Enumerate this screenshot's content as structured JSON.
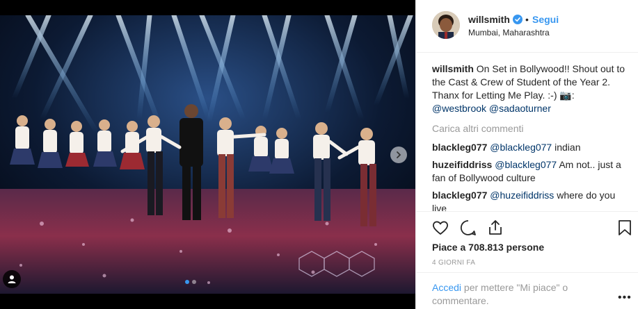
{
  "post": {
    "username": "willsmith",
    "bullet": "•",
    "follow_label": "Segui",
    "location": "Mumbai, Maharashtra",
    "caption": {
      "username": "willsmith",
      "text": "On Set in Bollywood!! Shout out to the Cast & Crew of Student of the Year 2. Thanx for Letting Me Play. :-) 📷:",
      "mention1": "@westbrook",
      "mention2": "@sadaoturner"
    },
    "load_more": "Carica altri commenti",
    "comments": [
      {
        "user": "blackleg077",
        "mention": "@blackleg077",
        "text": "indian"
      },
      {
        "user": "huzeifiddriss",
        "mention": "@blackleg077",
        "text": "Am not.. just a fan of Bollywood culture"
      },
      {
        "user": "blackleg077",
        "mention": "@huzeifiddriss",
        "text": "where do you live"
      }
    ],
    "likes": "Piace a 708.813 persone",
    "time_ago": "4 GIORNI FA",
    "footer": {
      "login_link": "Accedi",
      "login_text": "per mettere \"Mi piace\" o commentare.",
      "more": "•••"
    }
  },
  "media": {
    "carousel_total": 2,
    "carousel_active": 1
  },
  "colors": {
    "accent": "#3897f0",
    "link_dark": "#003569",
    "text": "#262626",
    "muted": "#999999",
    "border": "#efefef"
  },
  "icons": [
    "heart-icon",
    "comment-icon",
    "share-icon",
    "bookmark-icon",
    "verified-badge-icon",
    "chevron-right-icon",
    "user-tag-icon"
  ]
}
